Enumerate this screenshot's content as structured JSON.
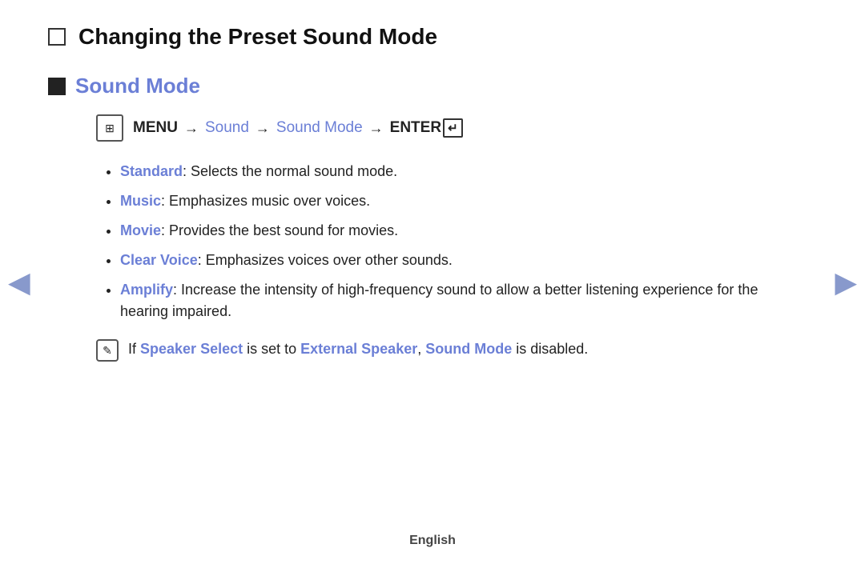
{
  "page": {
    "title": "Changing the Preset Sound Mode",
    "footer": "English"
  },
  "section": {
    "title": "Sound Mode"
  },
  "menu_path": {
    "menu_label": "MENU",
    "menu_icon_char": "⊞",
    "arrow": "→",
    "sound_label": "Sound",
    "sound_mode_label": "Sound Mode",
    "enter_label": "ENTER"
  },
  "bullets": [
    {
      "term": "Standard",
      "description": ": Selects the normal sound mode."
    },
    {
      "term": "Music",
      "description": ": Emphasizes music over voices."
    },
    {
      "term": "Movie",
      "description": ": Provides the best sound for movies."
    },
    {
      "term": "Clear Voice",
      "description": ": Emphasizes voices over other sounds."
    },
    {
      "term": "Amplify",
      "description": ": Increase the intensity of high-frequency sound to allow a better listening experience for the hearing impaired."
    }
  ],
  "note": {
    "icon_char": "✎",
    "text_before": "If ",
    "term1": "Speaker Select",
    "text_middle": " is set to ",
    "term2": "External Speaker",
    "separator": ", ",
    "term3": "Sound Mode",
    "text_after": " is disabled."
  },
  "nav": {
    "left_arrow": "◀",
    "right_arrow": "▶"
  }
}
